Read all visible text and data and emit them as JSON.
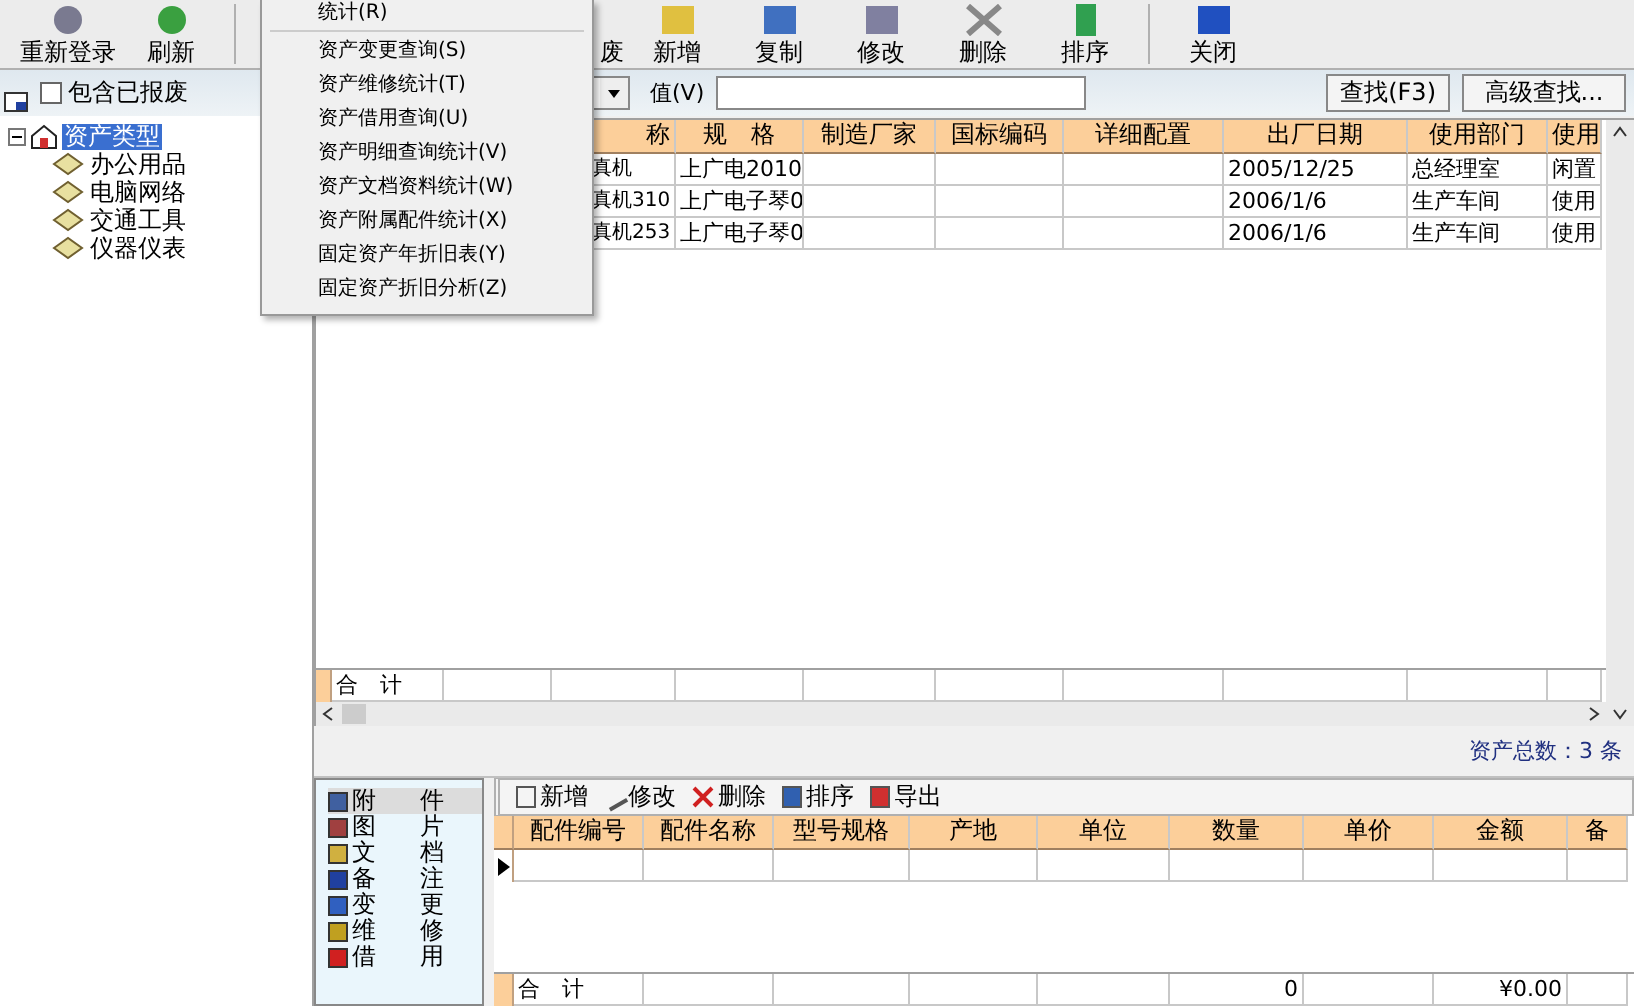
{
  "toolbar": {
    "buttons": [
      {
        "label": "重新登录",
        "kind": "login"
      },
      {
        "label": "刷新",
        "kind": "refresh"
      },
      {
        "label": "废",
        "kind": "scrap"
      },
      {
        "label": "新增",
        "kind": "add"
      },
      {
        "label": "复制",
        "kind": "copy"
      },
      {
        "label": "修改",
        "kind": "edit"
      },
      {
        "label": "删除",
        "kind": "delete"
      },
      {
        "label": "排序",
        "kind": "sort"
      },
      {
        "label": "关闭",
        "kind": "close"
      }
    ]
  },
  "menu": {
    "items": [
      {
        "label": "统计(R)"
      },
      {
        "label": "资产变更查询(S)"
      },
      {
        "label": "资产维修统计(T)"
      },
      {
        "label": "资产借用查询(U)"
      },
      {
        "label": "资产明细查询统计(V)"
      },
      {
        "label": "资产文档资料统计(W)"
      },
      {
        "label": "资产附属配件统计(X)"
      },
      {
        "label": "固定资产年折旧表(Y)"
      },
      {
        "label": "固定资产折旧分析(Z)"
      }
    ]
  },
  "sidebar": {
    "include_scrapped": {
      "label": "包含已报废",
      "checked": false
    },
    "tree": [
      {
        "label": "资产类型",
        "selected": true,
        "expanded": true,
        "children": [
          {
            "label": "办公用品",
            "selected": false
          },
          {
            "label": "电脑网络",
            "selected": false
          },
          {
            "label": "交通工具",
            "selected": false
          },
          {
            "label": "仪器仪表",
            "selected": false
          }
        ]
      }
    ]
  },
  "search": {
    "value_label": "值(V)",
    "find_button": "查找(F3)",
    "advanced_button": "高级查找..."
  },
  "table": {
    "columns": [
      "称",
      "规　格",
      "制造厂家",
      "国标编码",
      "详细配置",
      "出厂日期",
      "使用部门",
      "使用"
    ],
    "rows": [
      {
        "name": "真机",
        "spec": "上广电2010",
        "date": "2005/12/25",
        "department": "总经理室",
        "status": "闲置"
      },
      {
        "name": "真机310",
        "spec": "上广电子琴0",
        "date": "2006/1/6",
        "department": "生产车间",
        "status": "使用"
      },
      {
        "name": "真机253",
        "spec": "上广电子琴0",
        "date": "2006/1/6",
        "department": "生产车间",
        "status": "使用"
      }
    ],
    "footer": {
      "label": "合　计"
    }
  },
  "status_bar": {
    "total": "资产总数：3 条"
  },
  "detail": {
    "tabs": [
      {
        "label": "附",
        "label2": "件",
        "kind": "attach",
        "selected": true
      },
      {
        "label": "图",
        "label2": "片",
        "kind": "picture",
        "selected": false
      },
      {
        "label": "文",
        "label2": "档",
        "kind": "document",
        "selected": false
      },
      {
        "label": "备",
        "label2": "注",
        "kind": "note",
        "selected": false
      },
      {
        "label": "变",
        "label2": "更",
        "kind": "change",
        "selected": false
      },
      {
        "label": "维",
        "label2": "修",
        "kind": "repair",
        "selected": false
      },
      {
        "label": "借",
        "label2": "用",
        "kind": "borrow",
        "selected": false
      }
    ],
    "toolbar": [
      {
        "label": "新增",
        "kind": "add"
      },
      {
        "label": "修改",
        "kind": "edit"
      },
      {
        "label": "删除",
        "kind": "delete"
      },
      {
        "label": "排序",
        "kind": "sort"
      },
      {
        "label": "导出",
        "kind": "export"
      }
    ],
    "table": {
      "columns": [
        "配件编号",
        "配件名称",
        "型号规格",
        "产地",
        "单位",
        "数量",
        "单价",
        "金额",
        "备"
      ],
      "footer": {
        "label": "合　计",
        "quantity": "0",
        "amount": "¥0.00"
      }
    }
  }
}
